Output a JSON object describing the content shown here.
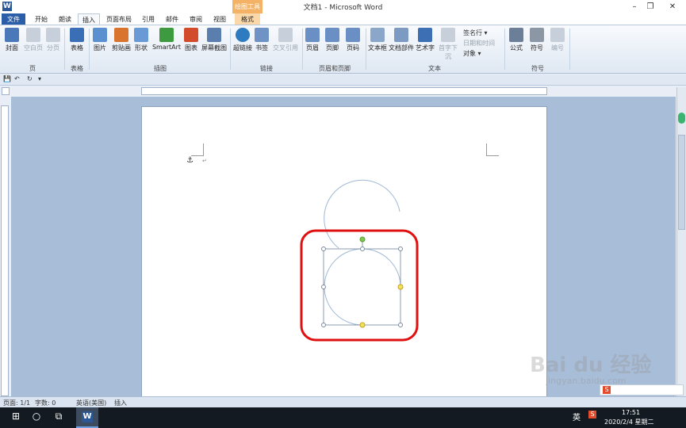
{
  "titlebar": {
    "logo": "W",
    "title": "文档1 - Microsoft Word",
    "context_header": "绘图工具",
    "minimize": "–",
    "maximize": "❐",
    "close": "✕"
  },
  "tabs": [
    {
      "label": "文件"
    },
    {
      "label": "开始"
    },
    {
      "label": "朗读"
    },
    {
      "label": "插入"
    },
    {
      "label": "页面布局"
    },
    {
      "label": "引用"
    },
    {
      "label": "邮件"
    },
    {
      "label": "审阅"
    },
    {
      "label": "视图"
    },
    {
      "label": "格式"
    }
  ],
  "ribbon": {
    "buttons": [
      {
        "label": "封面",
        "color": "#4a78b8"
      },
      {
        "label": "空白页",
        "color": "#c7cfdb"
      },
      {
        "label": "分页",
        "color": "#c7cfdb"
      },
      {
        "label": "表格",
        "color": "#3a6fb7"
      },
      {
        "label": "图片",
        "color": "#5a8fd0"
      },
      {
        "label": "剪贴画",
        "color": "#d9742e"
      },
      {
        "label": "形状",
        "color": "#6a9ad6"
      },
      {
        "label": "SmartArt",
        "color": "#3e9a3e"
      },
      {
        "label": "图表",
        "color": "#d24b2d"
      },
      {
        "label": "屏幕截图",
        "color": "#5a7fae"
      },
      {
        "label": "超链接",
        "color": "#2f7bbf"
      },
      {
        "label": "书签",
        "color": "#6f93c4"
      },
      {
        "label": "交叉引用",
        "color": "#c7cfdb"
      },
      {
        "label": "页眉",
        "color": "#6a8fc4"
      },
      {
        "label": "页脚",
        "color": "#6a8fc4"
      },
      {
        "label": "页码",
        "color": "#6a8fc4"
      },
      {
        "label": "文本框",
        "color": "#8aa6c9"
      },
      {
        "label": "文档部件",
        "color": "#7c9ac2"
      },
      {
        "label": "艺术字",
        "color": "#3d6fb4"
      },
      {
        "label": "首字下沉",
        "color": "#c7cfdb"
      },
      {
        "label": "公式",
        "color": "#6b7f99"
      },
      {
        "label": "符号",
        "color": "#8c97a6"
      },
      {
        "label": "编号",
        "color": "#c7cfdb"
      }
    ],
    "small": {
      "signature": "签名行 ▾",
      "datetime": "日期和时间",
      "object": "对象 ▾"
    },
    "groups": {
      "page": "页",
      "table": "表格",
      "illustrations": "插图",
      "links": "链接",
      "header_footer": "页眉和页脚",
      "text": "文本",
      "symbols": "符号"
    }
  },
  "qat": {
    "save": "💾",
    "undo": "↶",
    "redo": "↻",
    "more": "▾"
  },
  "document": {
    "anchor_icon": "⚓",
    "paragraph_mark": "↵"
  },
  "status": {
    "page": "页面: 1/1",
    "words": "字数: 0",
    "language": "英语(美国)",
    "mode": "插入"
  },
  "taskbar": {
    "start": "⊞",
    "search": "○",
    "taskview": "⧉",
    "word_app": "W",
    "ime": "英",
    "sogou": "S",
    "time": "17:51",
    "date": "2020/2/4 星期二"
  },
  "watermark": {
    "text": "Bai du 经验",
    "url": "jingyan.baidu.com"
  }
}
